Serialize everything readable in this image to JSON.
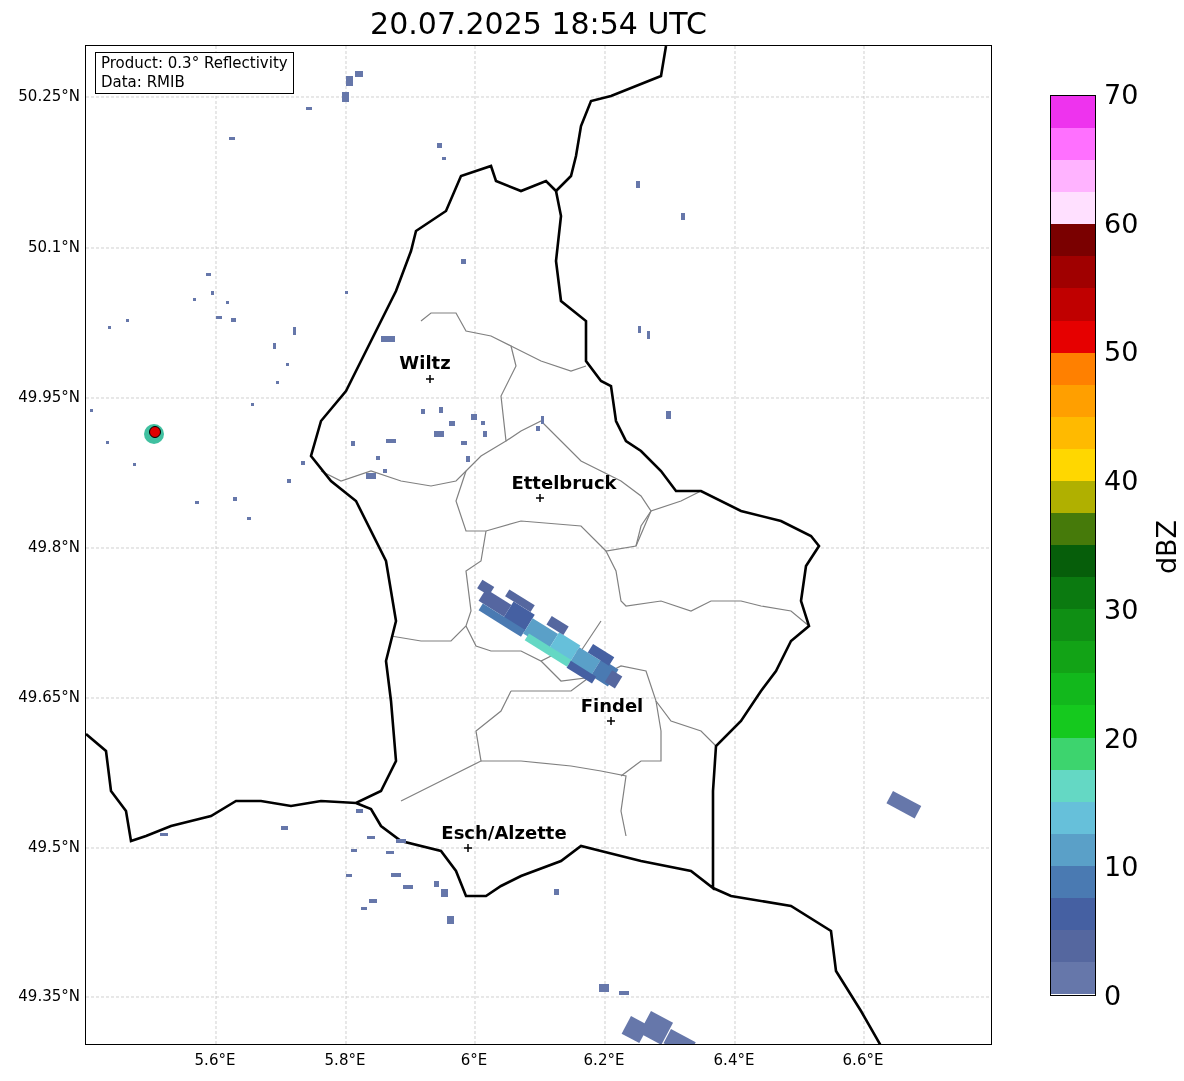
{
  "title": "20.07.2025 18:54 UTC",
  "info_box": [
    "Product: 0.3° Reflectivity",
    "Data: RMIB"
  ],
  "lat_ticks": [
    "50.25°N",
    "50.1°N",
    "49.95°N",
    "49.8°N",
    "49.65°N",
    "49.5°N",
    "49.35°N"
  ],
  "lon_ticks": [
    "5.6°E",
    "5.8°E",
    "6°E",
    "6.2°E",
    "6.4°E",
    "6.6°E"
  ],
  "cities": [
    {
      "name": "Wiltz"
    },
    {
      "name": "Ettelbruck"
    },
    {
      "name": "Findel"
    },
    {
      "name": "Esch/Alzette"
    }
  ],
  "colorbar": {
    "label": "dBZ",
    "ticks": [
      "70",
      "60",
      "50",
      "40",
      "30",
      "20",
      "10",
      "0"
    ],
    "segments": [
      {
        "color": "#ee33ee"
      },
      {
        "color": "#ff70ff"
      },
      {
        "color": "#ffb3ff"
      },
      {
        "color": "#ffe0ff"
      },
      {
        "color": "#7a0000"
      },
      {
        "color": "#a00000"
      },
      {
        "color": "#c00000"
      },
      {
        "color": "#e60000"
      },
      {
        "color": "#ff8000"
      },
      {
        "color": "#ff9f00"
      },
      {
        "color": "#ffba00"
      },
      {
        "color": "#ffd700"
      },
      {
        "color": "#b0b000"
      },
      {
        "color": "#467a0a"
      },
      {
        "color": "#065e0a"
      },
      {
        "color": "#0b7a10"
      },
      {
        "color": "#0f8f14"
      },
      {
        "color": "#12a316"
      },
      {
        "color": "#12b81c"
      },
      {
        "color": "#15c91e"
      },
      {
        "color": "#3dd46e"
      },
      {
        "color": "#64d8c4"
      },
      {
        "color": "#66c0da"
      },
      {
        "color": "#5aa0c8"
      },
      {
        "color": "#4a7ab2"
      },
      {
        "color": "#4560a2"
      },
      {
        "color": "#55679f"
      },
      {
        "color": "#6677aa"
      }
    ]
  }
}
